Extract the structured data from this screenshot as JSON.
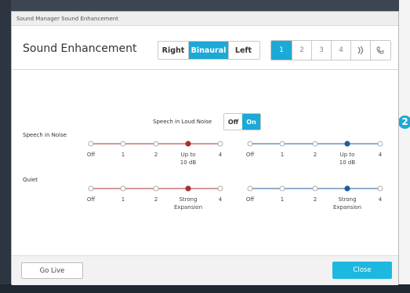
{
  "window": {
    "title": "Sound Manager Sound Enhancement"
  },
  "heading": "Sound Enhancement",
  "ear_selector": {
    "options": [
      "Right",
      "Binaural",
      "Left"
    ],
    "selected": "Binaural"
  },
  "program_selector": {
    "options": [
      "1",
      "2",
      "3",
      "4"
    ],
    "selected": "1",
    "icons": [
      "streaming-icon",
      "phone-icon"
    ]
  },
  "speech_in_loud_noise": {
    "label": "Speech in Loud Noise",
    "off": "Off",
    "on": "On",
    "selected": "On"
  },
  "rows": [
    {
      "label": "Speech in Noise",
      "ticks": [
        "Off",
        "1",
        "2",
        "Up to\n10 dB",
        "4"
      ],
      "left": {
        "value_index": 3
      },
      "right": {
        "value_index": 3
      }
    },
    {
      "label": "Quiet",
      "ticks": [
        "Off",
        "1",
        "2",
        "Strong\nExpansion",
        "4"
      ],
      "left": {
        "value_index": 3
      },
      "right": {
        "value_index": 3
      }
    }
  ],
  "footer": {
    "go_live": "Go Live",
    "close": "Close"
  },
  "side_badge": "2",
  "colors": {
    "accent": "#1ca9d6",
    "left_ear": "#a8302e",
    "right_ear": "#1f5f9e",
    "close_button": "#1cb8e0"
  }
}
